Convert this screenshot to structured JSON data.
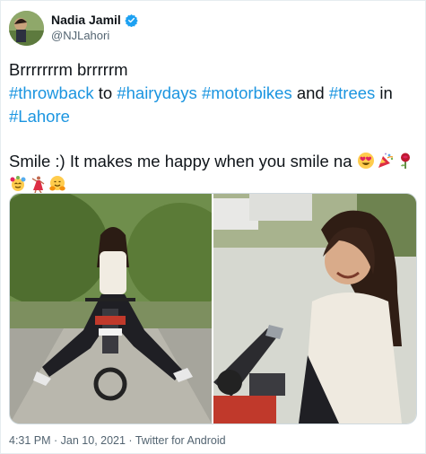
{
  "user": {
    "name": "Nadia Jamil",
    "handle": "@NJLahori",
    "verified_icon": "verified-badge-icon",
    "verified_color": "#1da1f2"
  },
  "tweet": {
    "line1": "Brrrrrrrm brrrrrm",
    "line2": {
      "tag_throwback": "#throwback",
      "word_to": " to ",
      "tag_hairydays": "#hairydays",
      "tag_motorbikes": "#motorbikes",
      "word_and": " and ",
      "tag_trees": "#trees",
      "word_in": " in"
    },
    "line3": {
      "tag_lahore": "#Lahore"
    },
    "line4": "Smile :) It makes me happy when you smile na",
    "emojis": [
      "heart-eyes-emoji",
      "party-popper-emoji",
      "rose-emoji",
      "cyclone-face-emoji",
      "dancer-emoji",
      "hugging-emoji"
    ],
    "hashtag_color": "#1b95e0"
  },
  "media": {
    "photos": [
      "photo-motorbike-wide",
      "photo-motorbike-closeup"
    ]
  },
  "meta": {
    "text": "4:31 PM · Jan 10, 2021 · Twitter for Android"
  }
}
